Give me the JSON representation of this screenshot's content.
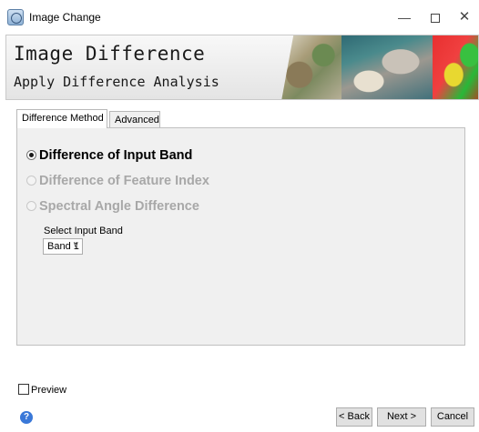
{
  "window": {
    "title": "Image Change",
    "minimize_glyph": "—",
    "close_glyph": "✕"
  },
  "banner": {
    "title": "Image Difference",
    "subtitle": "Apply Difference Analysis"
  },
  "tabs": [
    {
      "label": "Difference Method",
      "active": true
    },
    {
      "label": "Advanced",
      "active": false
    }
  ],
  "methods": [
    {
      "label": "Difference of Input Band",
      "selected": true,
      "enabled": true
    },
    {
      "label": "Difference of Feature Index",
      "selected": false,
      "enabled": false
    },
    {
      "label": "Spectral Angle Difference",
      "selected": false,
      "enabled": false
    }
  ],
  "band_select": {
    "label": "Select Input Band",
    "value": "Band 1",
    "chevron": "∨"
  },
  "preview": {
    "label": "Preview",
    "checked": false
  },
  "footer": {
    "help_glyph": "?",
    "back_label": "< Back",
    "next_label": "Next >",
    "cancel_label": "Cancel"
  },
  "colors": {
    "help_icon": "#3a78d8",
    "disabled_text": "#a8a8a8"
  }
}
